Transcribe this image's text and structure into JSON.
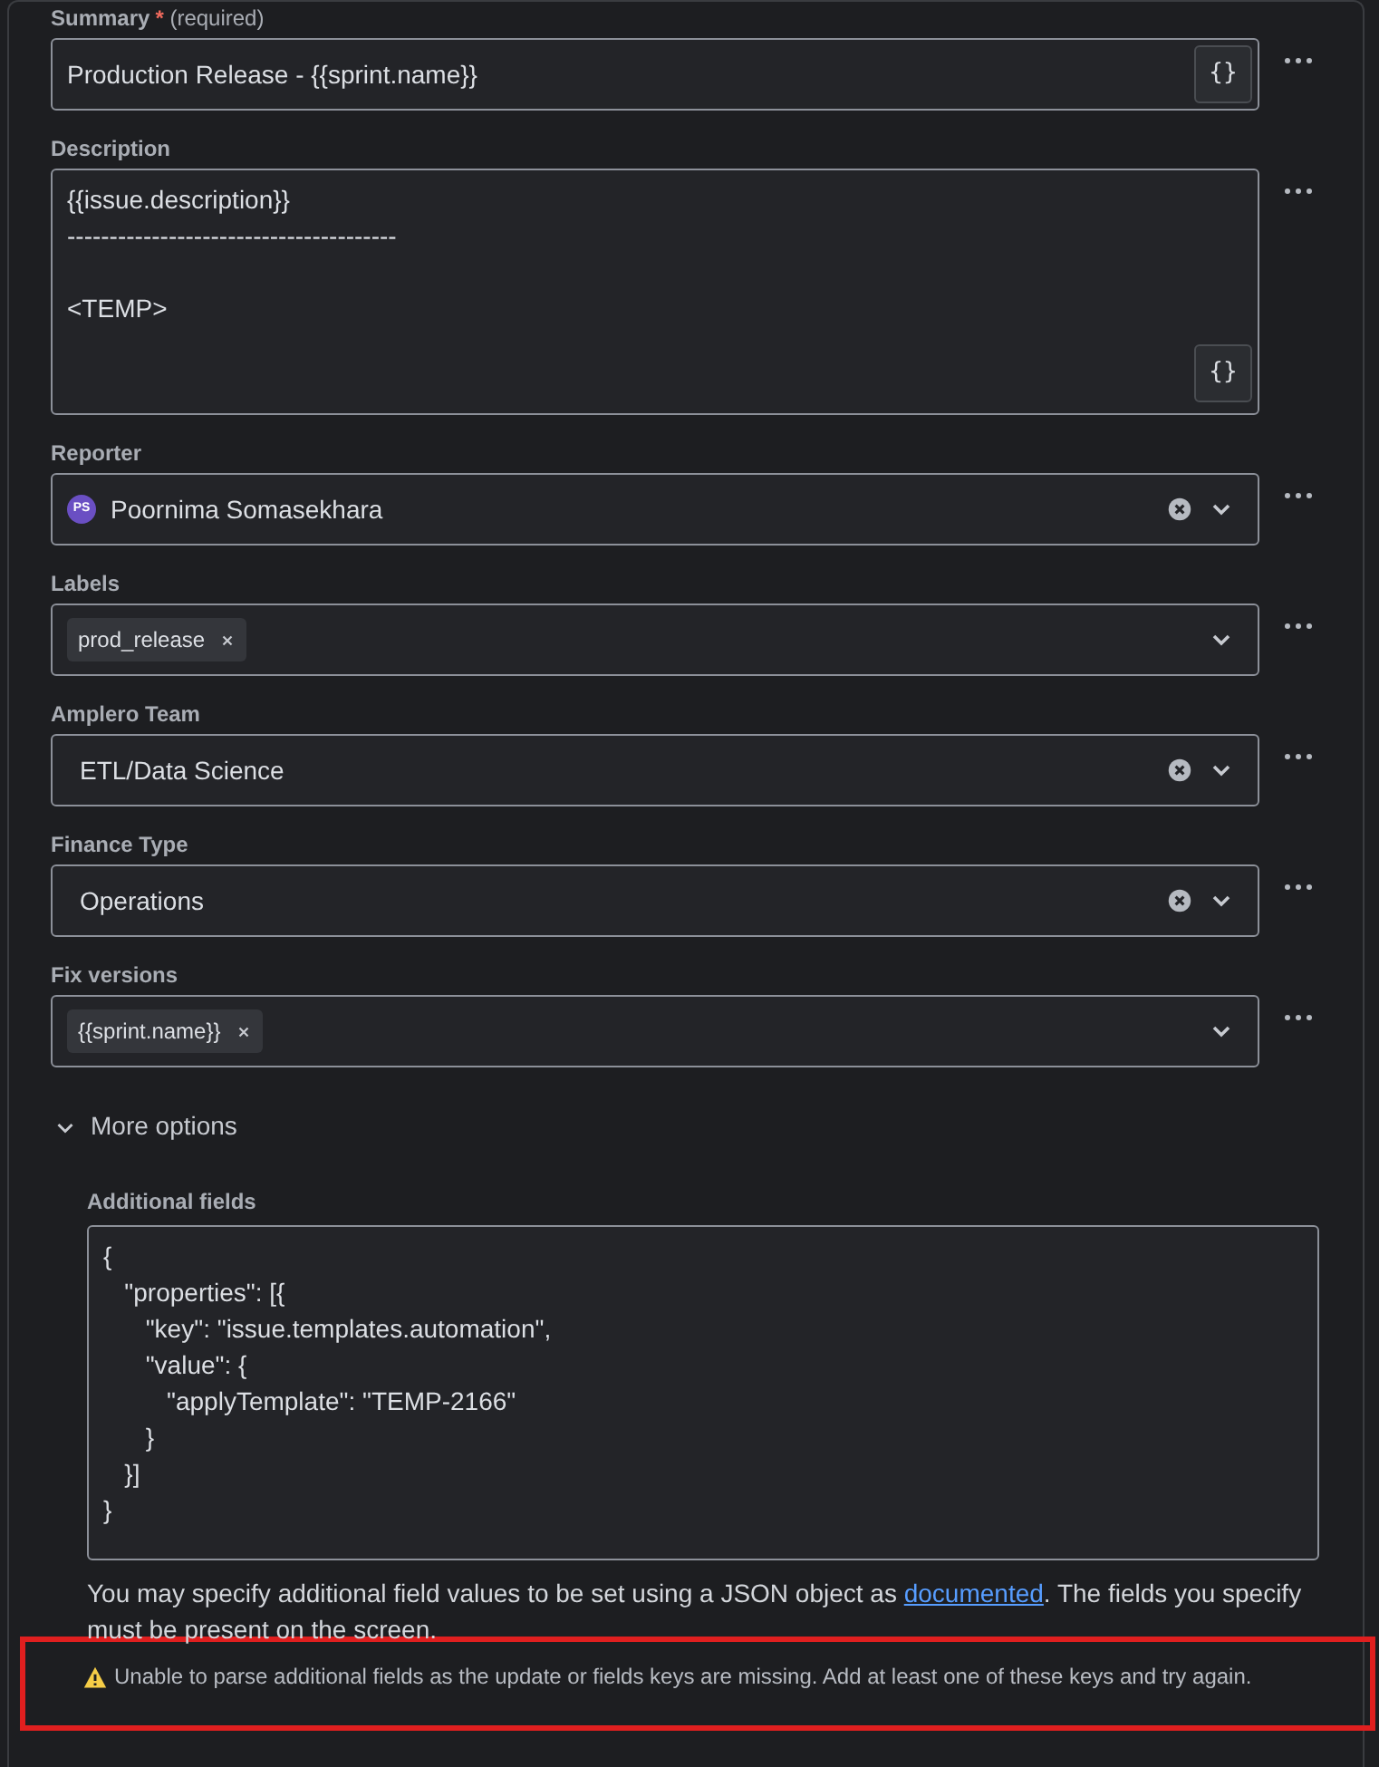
{
  "fields": [
    {
      "kind": "text",
      "label": "Summary",
      "required": true,
      "required_mark": "*",
      "required_note": "(required)",
      "value": "Production Release - {{sprint.name}}",
      "smart_button": "{}"
    },
    {
      "kind": "textarea",
      "label": "Description",
      "required": false,
      "value": "{{issue.description}}\n---------------------------------------\n\n<TEMP>",
      "smart_button": "{}"
    },
    {
      "kind": "user",
      "label": "Reporter",
      "required": false,
      "avatar_initials": "PS",
      "value": "Poornima Somasekhara",
      "clearable": true
    },
    {
      "kind": "tags",
      "label": "Labels",
      "required": false,
      "tags": [
        "prod_release"
      ],
      "clearable": false
    },
    {
      "kind": "select",
      "label": "Amplero Team",
      "required": false,
      "value": "ETL/Data Science",
      "clearable": true
    },
    {
      "kind": "select",
      "label": "Finance Type",
      "required": false,
      "value": "Operations",
      "clearable": true
    },
    {
      "kind": "tags",
      "label": "Fix versions",
      "required": false,
      "tags": [
        "{{sprint.name}}"
      ],
      "clearable": false
    }
  ],
  "more_options": {
    "label": "More options",
    "expanded": true
  },
  "additional_fields": {
    "label": "Additional fields",
    "lines": [
      "{",
      "   \"properties\": [{",
      "      \"key\": \"issue.templates.automation\",",
      "      \"value\": {",
      "         \"applyTemplate\": \"TEMP-2166\"",
      "      }",
      "   }]",
      "}"
    ]
  },
  "help": {
    "before": "You may specify additional field values to be set using a JSON object as ",
    "link": "documented",
    "after": ". The fields you specify must be present on the screen."
  },
  "warning": {
    "text": "Unable to parse additional fields as the update or fields keys are missing. Add at least one of these keys and try again.",
    "highlighted": true
  }
}
